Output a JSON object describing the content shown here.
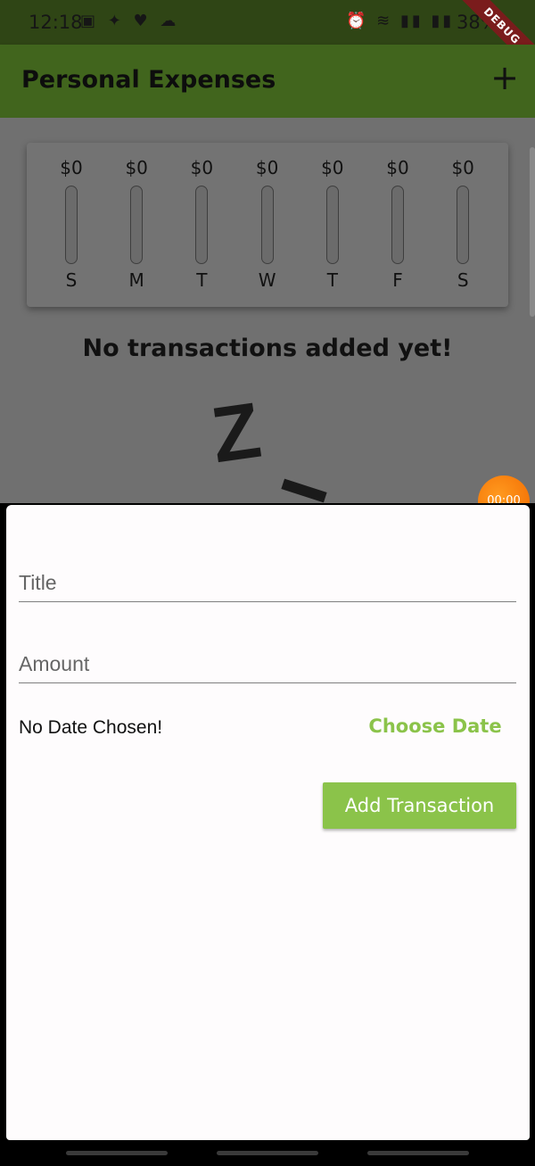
{
  "status_bar": {
    "time": "12:18",
    "left_icons": "▣ ✦ ♥ ☁",
    "right_icons": "⏰ ≋ ▮▮ ▮▮",
    "battery": "38%",
    "debug_label": "DEBUG"
  },
  "app_bar": {
    "title": "Personal Expenses",
    "add_icon": "+"
  },
  "chart_data": {
    "type": "bar",
    "categories": [
      "S",
      "M",
      "T",
      "W",
      "T",
      "F",
      "S"
    ],
    "labels": [
      "$0",
      "$0",
      "$0",
      "$0",
      "$0",
      "$0",
      "$0"
    ],
    "values": [
      0,
      0,
      0,
      0,
      0,
      0,
      0
    ],
    "title": "",
    "xlabel": "",
    "ylabel": ""
  },
  "empty_state": {
    "message": "No transactions added yet!",
    "image_text": "Z"
  },
  "overlay": {
    "timer": "00:00"
  },
  "form": {
    "title_placeholder": "Title",
    "amount_placeholder": "Amount",
    "date_status": "No Date Chosen!",
    "choose_date_label": "Choose Date",
    "submit_label": "Add Transaction"
  },
  "colors": {
    "primary": "#41651d",
    "accent": "#8bc34a",
    "timer": "#f26a00"
  }
}
